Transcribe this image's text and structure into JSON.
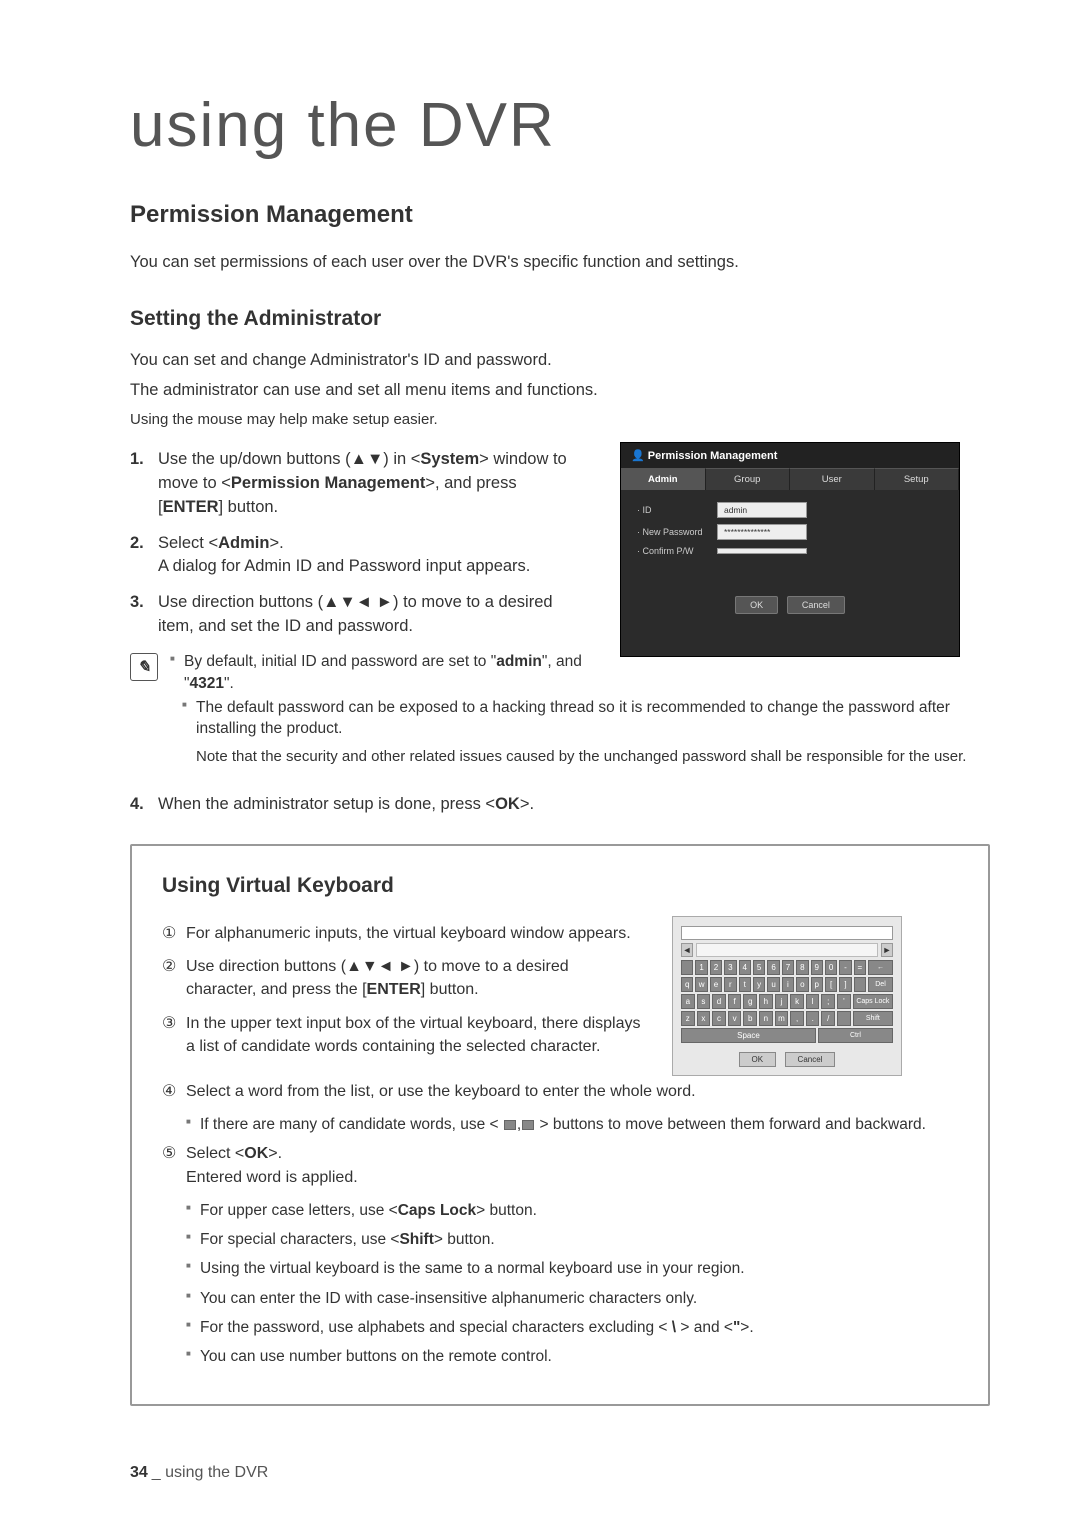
{
  "chapterTitle": "using the DVR",
  "section1": {
    "title": "Permission Management",
    "intro": "You can set permissions of each user over the DVR's specific function and settings."
  },
  "section2": {
    "title": "Setting the Administrator",
    "p1": "You can set and change Administrator's ID and password.",
    "p2": "The administrator can use and set all menu items and functions.",
    "smallNote": "Using the mouse may help make setup easier.",
    "steps": {
      "s1a": "Use the up/down buttons (▲▼) in <",
      "s1b": "> window to move to <",
      "s1c": ">, and press [",
      "s1d": "] button.",
      "s1_sys": "System",
      "s1_pm": "Permission Management",
      "s1_enter": "ENTER",
      "s2a": "Select <",
      "s2b": ">.",
      "s2_admin": "Admin",
      "s2c": "A dialog for Admin ID and Password input appears.",
      "s3": "Use direction buttons (▲▼◄ ►) to move to a desired item, and set the ID and password.",
      "s4a": "When the administrator setup is done, press <",
      "s4_ok": "OK",
      "s4b": ">."
    },
    "notes": {
      "n1a": "By default, initial ID and password are set to \"",
      "n1_admin": "admin",
      "n1b": "\", and \"",
      "n1_pw": "4321",
      "n1c": "\".",
      "n2": "The default password can be exposed to a hacking thread so it is recommended to change the password after installing the product.",
      "n2sub": "Note that the security and other related issues caused by the unchanged password shall be responsible for the user."
    }
  },
  "dialog": {
    "title": "Permission Management",
    "tabs": [
      "Admin",
      "Group",
      "User",
      "Setup"
    ],
    "fields": {
      "id_label": "· ID",
      "id_value": "admin",
      "pw_label": "· New Password",
      "pw_value": "**************",
      "cpw_label": "· Confirm P/W",
      "cpw_value": ""
    },
    "ok": "OK",
    "cancel": "Cancel"
  },
  "vk": {
    "title": "Using Virtual Keyboard",
    "li1": "For alphanumeric inputs, the virtual keyboard window appears.",
    "li2a": "Use direction buttons (▲▼◄ ►) to move to a desired character, and press the [",
    "li2_enter": "ENTER",
    "li2b": "] button.",
    "li3": "In the upper text input box of the virtual keyboard, there displays a list of candidate words containing the selected character.",
    "li4": "Select a word from the list, or use the keyboard to enter the whole word.",
    "li4_sub_a": "If there are many of candidate words, use < ",
    "li4_sub_b": " > buttons to move between them forward and backward.",
    "li5a": "Select <",
    "li5_ok": "OK",
    "li5b": ">.",
    "li5c": "Entered word is applied.",
    "subs": {
      "s1a": "For upper case letters, use <",
      "s1_caps": "Caps Lock",
      "s1b": "> button.",
      "s2a": "For special characters, use <",
      "s2_shift": "Shift",
      "s2b": "> button.",
      "s3": "Using the virtual keyboard is the same to a normal keyboard use in your region.",
      "s4": "You can enter the ID with case-insensitive alphanumeric characters only.",
      "s5a": "For the password, use alphabets and special characters excluding < ",
      "s5_bs": "\\",
      "s5b": " > and <",
      "s5_q": "\"",
      "s5c": ">.",
      "s6": "You can use number buttons on the remote control."
    },
    "keys": {
      "row1": [
        "",
        "1",
        "2",
        "3",
        "4",
        "5",
        "6",
        "7",
        "8",
        "9",
        "0",
        "-",
        "=",
        "←"
      ],
      "row2": [
        "q",
        "w",
        "e",
        "r",
        "t",
        "y",
        "u",
        "i",
        "o",
        "p",
        "[",
        "]",
        "",
        "Del"
      ],
      "row3": [
        "a",
        "s",
        "d",
        "f",
        "g",
        "h",
        "j",
        "k",
        "l",
        ";",
        "'",
        "Caps Lock"
      ],
      "row4": [
        "z",
        "x",
        "c",
        "v",
        "b",
        "n",
        "m",
        ",",
        ".",
        "/",
        "",
        "Shift"
      ],
      "space": "Space",
      "ctrl": "Ctrl",
      "ok": "OK",
      "cancel": "Cancel",
      "left": "◄",
      "right": "►"
    }
  },
  "footer": {
    "pageNum": "34",
    "label": "_ using the DVR"
  }
}
